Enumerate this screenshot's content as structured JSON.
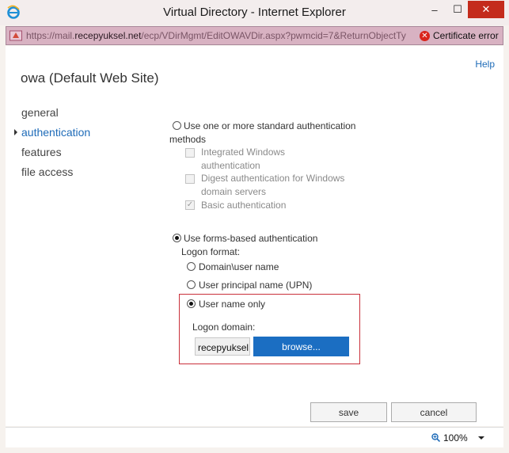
{
  "window": {
    "title": "Virtual Directory - Internet Explorer",
    "controls": {
      "minimize": "–",
      "maximize": "☐",
      "close": "✕"
    }
  },
  "address_bar": {
    "url_prefix": "https://mail.",
    "url_domain": "recepyuksel.net",
    "url_suffix": "/ecp/VDirMgmt/EditOWAVDir.aspx?pwmcid=7&ReturnObjectTy",
    "cert_error": "Certificate error"
  },
  "header": {
    "help": "Help",
    "page_title": "owa (Default Web Site)"
  },
  "left_nav": [
    {
      "label": "general",
      "active": false
    },
    {
      "label": "authentication",
      "active": true
    },
    {
      "label": "features",
      "active": false
    },
    {
      "label": "file access",
      "active": false
    }
  ],
  "auth": {
    "standard_option_line1": "Use one or more standard authentication",
    "standard_option_line2": "methods",
    "integrated_line1": "Integrated Windows",
    "integrated_line2": "authentication",
    "digest_line1": "Digest authentication for Windows",
    "digest_line2": "domain servers",
    "basic": "Basic authentication",
    "forms_option": "Use forms-based authentication",
    "logon_format_label": "Logon format:",
    "format_domain_user": "Domain\\user name",
    "format_upn": "User principal name (UPN)",
    "format_username_only": "User name only",
    "logon_domain_label": "Logon domain:",
    "logon_domain_value": "recepyuksel.net",
    "browse_button": "browse...",
    "selected_method": "forms",
    "selected_format": "username_only",
    "basic_checked": true
  },
  "footer": {
    "save": "save",
    "cancel": "cancel"
  },
  "status_bar": {
    "zoom": "100%"
  },
  "colors": {
    "accent": "#1e6bb8",
    "browse_button": "#1b6ec2",
    "highlight_border": "#c9303a",
    "address_bar_error": "#d8b2c2",
    "close_button": "#c42b1c"
  },
  "icons": [
    "ie-icon",
    "shield-icon",
    "certificate-error-icon",
    "zoom-icon",
    "chevron-down-icon",
    "nav-arrow-icon"
  ]
}
